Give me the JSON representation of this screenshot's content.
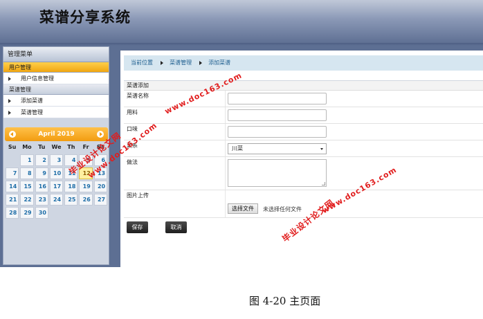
{
  "app": {
    "title": "菜谱分享系统"
  },
  "sidebar": {
    "title": "管理菜单",
    "groups": [
      {
        "label": "用户管理",
        "items": [
          {
            "label": "用户信息管理"
          }
        ]
      },
      {
        "label": "菜谱管理",
        "items": [
          {
            "label": "添加菜谱"
          },
          {
            "label": "菜谱管理"
          }
        ]
      }
    ]
  },
  "calendar": {
    "month_label": "April 2019",
    "weekdays": [
      "Su",
      "Mo",
      "Tu",
      "We",
      "Th",
      "Fr",
      "Sa"
    ],
    "leading_blanks": 1,
    "days": [
      "1",
      "2",
      "3",
      "4",
      "5",
      "6",
      "7",
      "8",
      "9",
      "10",
      "11",
      "12",
      "13",
      "14",
      "15",
      "16",
      "17",
      "18",
      "19",
      "20",
      "21",
      "22",
      "23",
      "24",
      "25",
      "26",
      "27",
      "28",
      "29",
      "30"
    ],
    "today": "12"
  },
  "breadcrumb": {
    "items": [
      "当前位置",
      "菜谱管理",
      "添加菜谱"
    ]
  },
  "form": {
    "title": "菜谱添加",
    "fields": {
      "name_label": "菜谱名称",
      "ingredients_label": "用料",
      "taste_label": "口味",
      "cuisine_label": "菜系",
      "cuisine_value": "川菜",
      "method_label": "做法",
      "image_label": "图片上传",
      "file_button": "选择文件",
      "file_status": "未选择任何文件"
    },
    "save_button": "保存",
    "cancel_button": "取消"
  },
  "watermarks": {
    "left_top": "毕业设计论文网",
    "left_url": "www.doc163.com",
    "top_url": "www.doc163.com",
    "right_url": "www.doc163.com",
    "right_text": "毕业设计论文网"
  },
  "caption": "图 4-20 主页面",
  "colors": {
    "header_bg": "#5d6f93",
    "active_group": "#f0a512",
    "calendar_header": "#f29c10",
    "breadcrumb_bg": "#d6e6f0",
    "watermark": "#e11d1d"
  }
}
